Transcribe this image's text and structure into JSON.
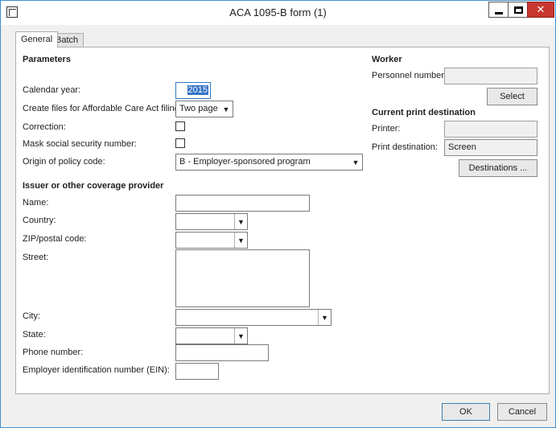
{
  "window": {
    "title": "ACA 1095-B form (1)"
  },
  "tabs": [
    {
      "label": "General"
    },
    {
      "label": "Batch"
    }
  ],
  "parameters": {
    "title": "Parameters",
    "calendar_year_label": "Calendar year:",
    "calendar_year_value": "2015",
    "create_files_label": "Create files for Affordable Care Act filing:",
    "create_files_value": "Two page",
    "correction_label": "Correction:",
    "correction_checked": false,
    "mask_ssn_label": "Mask social security number:",
    "mask_ssn_checked": false,
    "origin_label": "Origin of policy code:",
    "origin_value": "B - Employer-sponsored program"
  },
  "issuer": {
    "title": "Issuer or other coverage provider",
    "name_label": "Name:",
    "name_value": "",
    "country_label": "Country:",
    "country_value": "",
    "zip_label": "ZIP/postal code:",
    "zip_value": "",
    "street_label": "Street:",
    "street_value": "",
    "city_label": "City:",
    "city_value": "",
    "state_label": "State:",
    "state_value": "",
    "phone_label": "Phone number:",
    "phone_value": "",
    "ein_label": "Employer identification number (EIN):",
    "ein_value": ""
  },
  "worker": {
    "title": "Worker",
    "personnel_label": "Personnel number:",
    "personnel_value": "",
    "select_button": "Select"
  },
  "print": {
    "title": "Current print destination",
    "printer_label": "Printer:",
    "printer_value": "",
    "destination_label": "Print destination:",
    "destination_value": "Screen",
    "destinations_button": "Destinations ..."
  },
  "footer": {
    "ok_button": "OK",
    "cancel_button": "Cancel"
  },
  "icons": {
    "app": "form-icon",
    "minimize": "minimize-icon",
    "maximize": "maximize-icon",
    "close": "close-icon",
    "dropdown": "chevron-down-icon"
  },
  "colors": {
    "accent": "#3c8fd1",
    "selection": "#3474c6",
    "close": "#c7372f"
  }
}
